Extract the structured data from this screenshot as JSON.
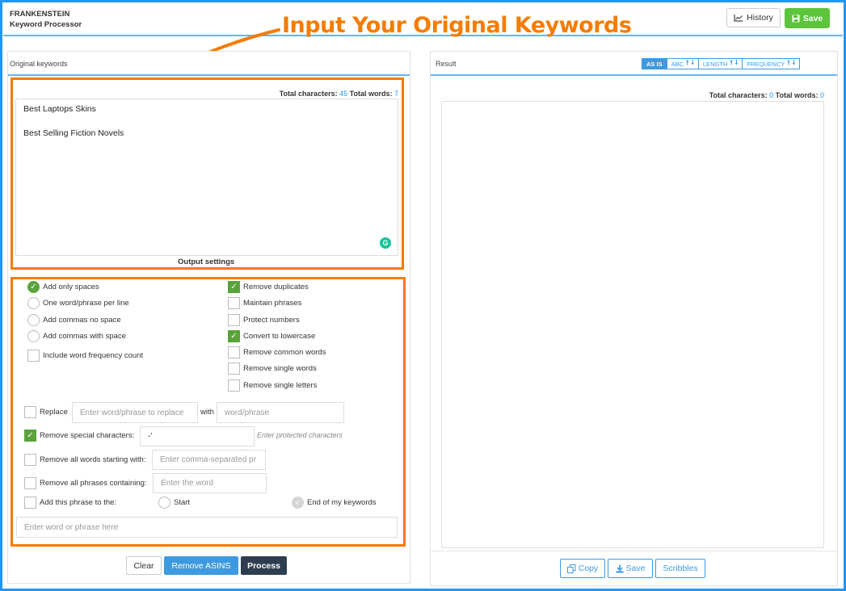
{
  "header": {
    "app_name": "FRANKENSTEIN",
    "app_subtitle": "Keyword Processor",
    "history_label": "History",
    "save_label": "Save"
  },
  "annotation": {
    "text": "Input Your Original Keywords",
    "color": "#f57c00"
  },
  "left_panel": {
    "title": "Original keywords",
    "counts": {
      "chars_label": "Total characters:",
      "chars": "45",
      "words_label": "Total words:",
      "words": "7"
    },
    "keywords": [
      "Best Laptops Skins",
      "Best Selling Fiction Novels"
    ],
    "output_settings_label": "Output settings"
  },
  "format_options": [
    {
      "label": "Add only spaces",
      "checked": true
    },
    {
      "label": "One word/phrase per line",
      "checked": false
    },
    {
      "label": "Add commas no space",
      "checked": false
    },
    {
      "label": "Add commas with space",
      "checked": false
    }
  ],
  "frequency_option": {
    "label": "Include word frequency count",
    "checked": false
  },
  "processing_options": [
    {
      "label": "Remove duplicates",
      "checked": true
    },
    {
      "label": "Maintain phrases",
      "checked": false
    },
    {
      "label": "Protect numbers",
      "checked": false
    },
    {
      "label": "Convert to lowercase",
      "checked": true
    },
    {
      "label": "Remove common words",
      "checked": false
    },
    {
      "label": "Remove single words",
      "checked": false
    },
    {
      "label": "Remove single letters",
      "checked": false
    }
  ],
  "replace": {
    "label": "Replace",
    "find_placeholder": "Enter word/phrase to replace",
    "with_label": "with",
    "replace_placeholder": "word/phrase",
    "checked": false
  },
  "special_chars": {
    "label": "Remove special characters:",
    "value": "-'",
    "hint": "Enter protected characters",
    "checked": true
  },
  "starting_with": {
    "label": "Remove all words starting with:",
    "placeholder": "Enter comma-separated pr",
    "checked": false
  },
  "phrases_containing": {
    "label": "Remove all phrases containing:",
    "placeholder": "Enter the word",
    "checked": false
  },
  "add_phrase": {
    "label": "Add this phrase to the:",
    "start_label": "Start",
    "end_label": "End of my keywords",
    "placeholder": "Enter word or phrase here",
    "checked": false
  },
  "actions": {
    "clear": "Clear",
    "remove_asins": "Remove ASINS",
    "process": "Process"
  },
  "right_panel": {
    "title": "Result",
    "sort": {
      "as_is": "AS IS",
      "abc": "ABC",
      "length": "LENGTH",
      "frequency": "FREQUENCY",
      "up_arrow": "🠕",
      "down_arrow": "🠗"
    },
    "counts": {
      "chars_label": "Total characters:",
      "chars": "0",
      "words_label": "Total words:",
      "words": "0"
    },
    "buttons": {
      "copy": "Copy",
      "save": "Save",
      "scribbles": "Scribbles"
    }
  },
  "colors": {
    "accent_blue": "#2196f3",
    "save_green": "#5cc53c",
    "check_green": "#5aa33a",
    "highlight_orange": "#f57c00",
    "process_dark": "#2e3e50"
  }
}
